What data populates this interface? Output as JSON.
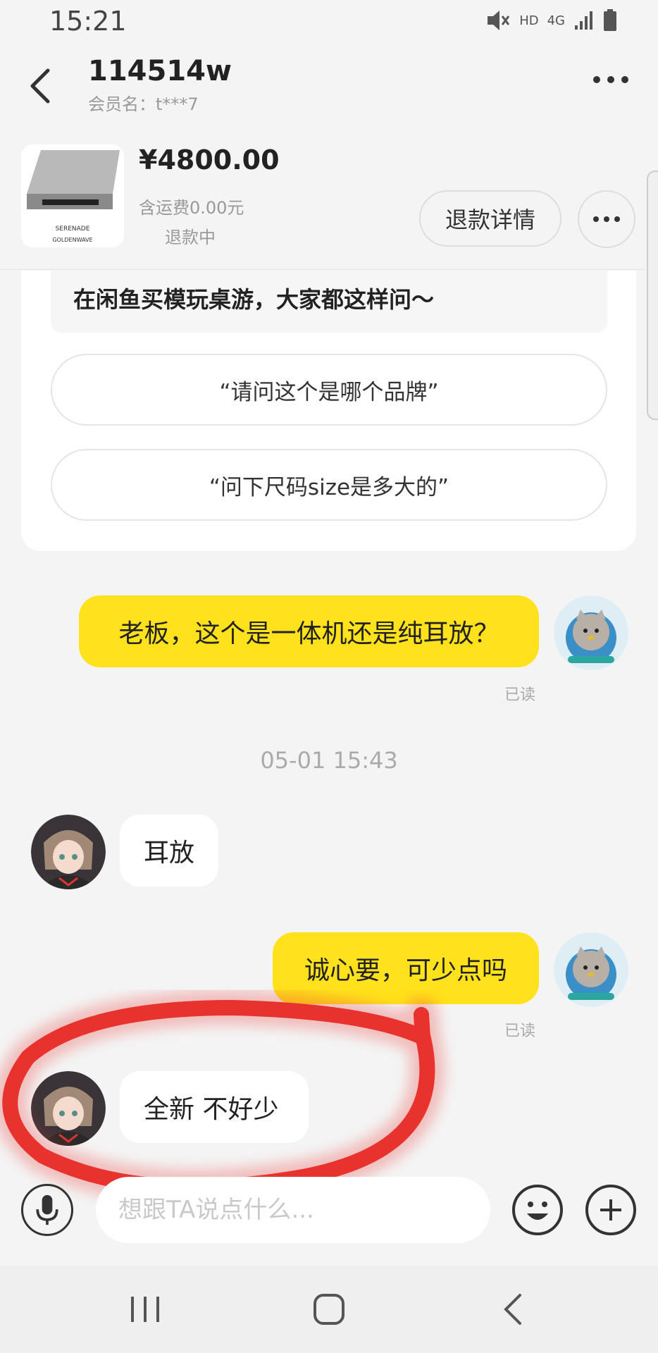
{
  "status_bar": {
    "time": "15:21",
    "network": "4G",
    "hd": "HD"
  },
  "header": {
    "title": "114514w",
    "member": "会员名：t***7"
  },
  "product": {
    "price": "¥4800.00",
    "shipping": "含运费0.00元",
    "state": "退款中",
    "refund_button": "退款详情",
    "image_text_1": "SERENADE",
    "image_text_2": "GOLDENWAVE"
  },
  "suggestions": {
    "title": "在闲鱼买模玩桌游，大家都这样问～",
    "items": [
      "“请问这个是哪个品牌”",
      "“问下尺码size是多大的”"
    ]
  },
  "chat": {
    "timestamp": "05-01 15:43",
    "messages": [
      {
        "from": "me",
        "text": "老板，这个是一体机还是纯耳放？",
        "status": "已读"
      },
      {
        "from": "other",
        "text": "耳放"
      },
      {
        "from": "me",
        "text": "诚心要，可少点吗",
        "status": "已读"
      },
      {
        "from": "other",
        "text": "全新 不好少"
      }
    ]
  },
  "input": {
    "placeholder": "想跟TA说点什么..."
  },
  "colors": {
    "accent": "#ffe21b",
    "annotation": "#e8322e"
  },
  "icons": [
    "back-icon",
    "more-icon",
    "mic-icon",
    "emoji-icon",
    "plus-icon",
    "recents-icon",
    "home-icon",
    "nav-back-icon"
  ]
}
